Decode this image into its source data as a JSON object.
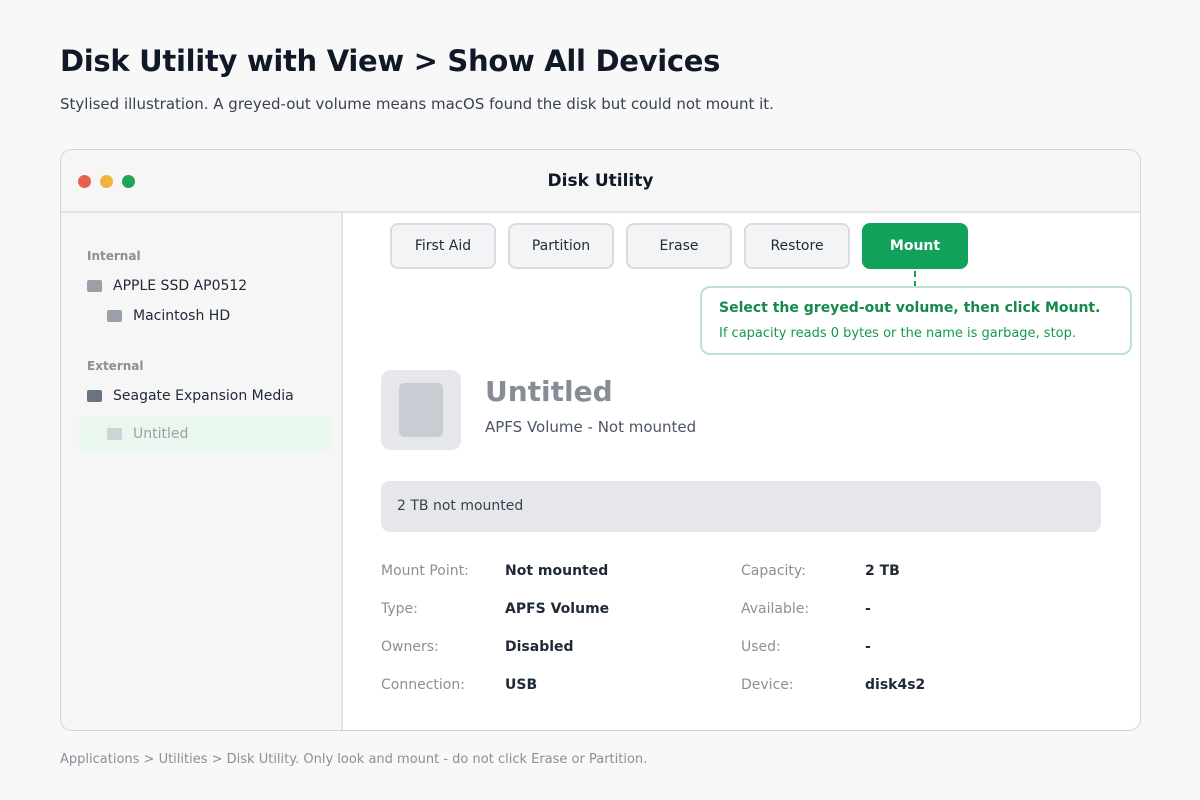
{
  "page": {
    "title": "Disk Utility with View > Show All Devices",
    "subtitle": "Stylised illustration. A greyed-out volume means macOS found the disk but could not mount it.",
    "footer": "Applications > Utilities > Disk Utility. Only look and mount - do not click Erase or Partition."
  },
  "window": {
    "title": "Disk Utility",
    "traffic_lights": [
      "#e8604c",
      "#eeb43f",
      "#1fa45a"
    ]
  },
  "sidebar": {
    "internal_label": "Internal",
    "external_label": "External",
    "items": [
      {
        "label": "APPLE SSD AP0512",
        "icon": "disk-icon",
        "color": "#9aa0a8"
      },
      {
        "label": "Macintosh HD",
        "icon": "volume-icon",
        "color": "#9aa0a8"
      },
      {
        "label": "Seagate Expansion Media",
        "icon": "disk-icon",
        "color": "#6b7280"
      },
      {
        "label": "Untitled",
        "icon": "volume-icon",
        "color": "#cfd2d7",
        "selected": true
      }
    ]
  },
  "toolbar": {
    "first_aid": "First Aid",
    "partition": "Partition",
    "erase": "Erase",
    "restore": "Restore",
    "mount": "Mount"
  },
  "callout": {
    "title": "Select the greyed-out volume, then click Mount.",
    "body": "If capacity reads 0 bytes or the name is garbage, stop."
  },
  "volume": {
    "name": "Untitled",
    "description": "APFS Volume - Not mounted",
    "capacity_bar": "2 TB not mounted"
  },
  "details": {
    "mount_point_label": "Mount Point:",
    "mount_point": "Not mounted",
    "type_label": "Type:",
    "type": "APFS Volume",
    "owners_label": "Owners:",
    "owners": "Disabled",
    "connection_label": "Connection:",
    "connection": "USB",
    "capacity_label": "Capacity:",
    "capacity": "2 TB",
    "available_label": "Available:",
    "available": "-",
    "used_label": "Used:",
    "used": "-",
    "device_label": "Device:",
    "device": "disk4s2"
  },
  "colors": {
    "accent": "#12a15a",
    "callout_border": "#b9e3cb",
    "selected_bg": "#e9f7ef"
  }
}
